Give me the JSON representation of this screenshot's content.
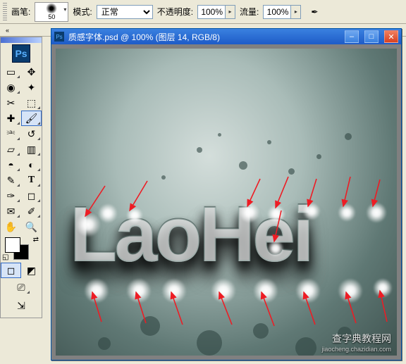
{
  "options": {
    "brush_label": "画笔:",
    "brush_size": "50",
    "mode_label": "模式:",
    "mode_value": "正常",
    "opacity_label": "不透明度:",
    "opacity_value": "100%",
    "flow_label": "流量:",
    "flow_value": "100%"
  },
  "titlebar": {
    "filename": "质感字体.psd",
    "zoom": "100%",
    "layer": "图层 14",
    "colormode": "RGB/8"
  },
  "canvas": {
    "text": "LaoHei"
  },
  "watermark": {
    "line1": "查字典教程网",
    "line2": "jiaocheng.chazidian.com"
  },
  "icons": {
    "chev_down": "▾",
    "chev_right": "▸",
    "airbrush": "✒",
    "close": "✕",
    "min": "–",
    "max": "□",
    "move": "✥",
    "marquee": "▭",
    "lasso": "◉",
    "wand": "✦",
    "crop": "✂",
    "slice": "⬚",
    "heal": "✚",
    "brush": "🖌",
    "stamp": "⎃",
    "history": "↺",
    "eraser": "▱",
    "gradient": "▥",
    "blur": "◓",
    "dodge": "◐",
    "path": "✎",
    "type": "T",
    "pen": "✑",
    "shape": "◻",
    "notes": "✉",
    "eyedrop": "✐",
    "hand": "✋",
    "zoom": "🔍",
    "swap": "⇄",
    "reset": "◱",
    "std": "◻",
    "qm": "◩",
    "screen": "⎚",
    "jump": "⇲"
  }
}
